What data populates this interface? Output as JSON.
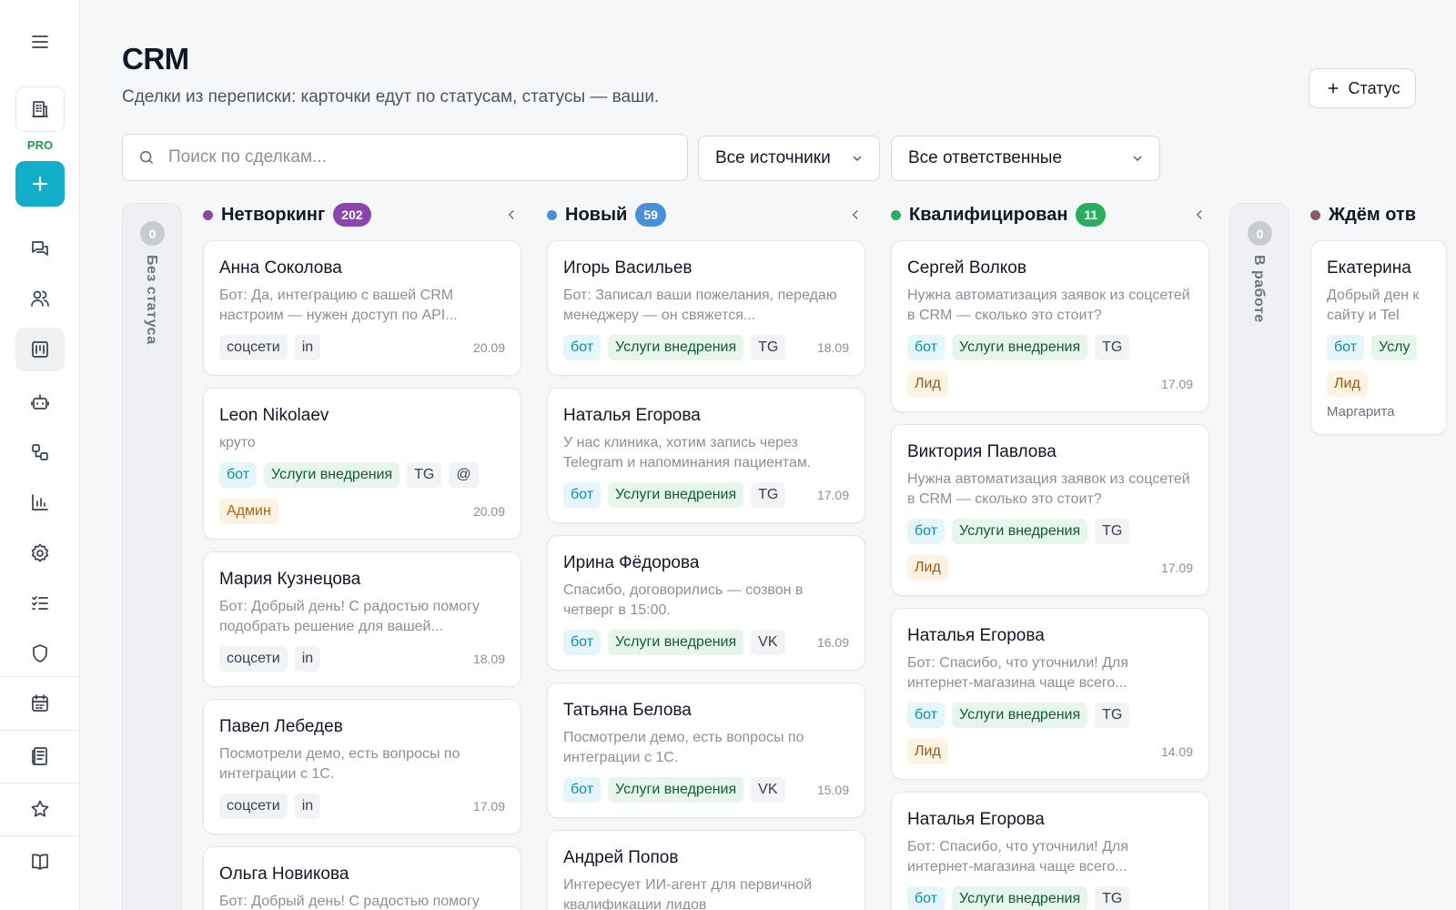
{
  "page": {
    "title": "CRM",
    "subtitle": "Сделки из переписки: карточки едут по статусам, статусы — ваши.",
    "add_status_label": "Статус"
  },
  "sidebar": {
    "pro_label": "PRO",
    "icons": [
      "menu-icon",
      "workspace-icon",
      "plus-icon",
      "chats-icon",
      "contacts-icon",
      "crm-board-icon",
      "bot-icon",
      "workflow-icon",
      "analytics-icon",
      "settings-icon",
      "tasks-icon",
      "shield-icon",
      "calendar-icon",
      "knowledge-icon",
      "star-icon",
      "book-icon"
    ]
  },
  "filters": {
    "search_placeholder": "Поиск по сделкам...",
    "source_value": "Все источники",
    "owner_value": "Все ответственные"
  },
  "collapsed_columns": [
    {
      "label": "Без статуса",
      "count": "0"
    },
    {
      "label": "В работе",
      "count": "0"
    }
  ],
  "columns": [
    {
      "name": "Нетворкинг",
      "count": "202",
      "color": "#8e44ad",
      "cards": [
        {
          "name": "Анна Соколова",
          "message": "Бот: Да, интеграцию с вашей CRM настроим — нужен доступ по API...",
          "tags": [
            "соцсети",
            "in"
          ],
          "date": "20.09"
        },
        {
          "name": "Leon Nikolaev",
          "message": "круто",
          "tags": [
            "бот",
            "Услуги внедрения",
            "TG",
            "@"
          ],
          "role": "Админ",
          "date": "20.09"
        },
        {
          "name": "Мария Кузнецова",
          "message": "Бот: Добрый день! С радостью помогу подобрать решение для вашей...",
          "tags": [
            "соцсети",
            "in"
          ],
          "date": "18.09"
        },
        {
          "name": "Павел Лебедев",
          "message": "Посмотрели демо, есть вопросы по интеграции с 1С.",
          "tags": [
            "соцсети",
            "in"
          ],
          "date": "17.09"
        },
        {
          "name": "Ольга Новикова",
          "message": "Бот: Добрый день! С радостью помогу",
          "tags": [],
          "date": ""
        }
      ]
    },
    {
      "name": "Новый",
      "count": "59",
      "color": "#4a90d9",
      "cards": [
        {
          "name": "Игорь Васильев",
          "message": "Бот: Записал ваши пожелания, передаю менеджеру — он свяжется...",
          "tags": [
            "бот",
            "Услуги внедрения",
            "TG"
          ],
          "date": "18.09"
        },
        {
          "name": "Наталья Егорова",
          "message": "У нас клиника, хотим запись через Telegram и напоминания пациентам.",
          "tags": [
            "бот",
            "Услуги внедрения",
            "TG"
          ],
          "date": "17.09"
        },
        {
          "name": "Ирина Фёдорова",
          "message": "Спасибо, договорились — созвон в четверг в 15:00.",
          "tags": [
            "бот",
            "Услуги внедрения",
            "VK"
          ],
          "date": "16.09"
        },
        {
          "name": "Татьяна Белова",
          "message": "Посмотрели демо, есть вопросы по интеграции с 1С.",
          "tags": [
            "бот",
            "Услуги внедрения",
            "VK"
          ],
          "date": "15.09"
        },
        {
          "name": "Андрей Попов",
          "message": "Интересует ИИ-агент для первичной квалификации лидов",
          "tags": [],
          "date": ""
        }
      ]
    },
    {
      "name": "Квалифицирован",
      "count": "11",
      "color": "#27ae60",
      "cards": [
        {
          "name": "Сергей Волков",
          "message": "Нужна автоматизация заявок из соцсетей в CRM — сколько это стоит?",
          "tags": [
            "бот",
            "Услуги внедрения",
            "TG"
          ],
          "role": "Лид",
          "date": "17.09"
        },
        {
          "name": "Виктория Павлова",
          "message": "Нужна автоматизация заявок из соцсетей в CRM — сколько это стоит?",
          "tags": [
            "бот",
            "Услуги внедрения",
            "TG"
          ],
          "role": "Лид",
          "date": "17.09"
        },
        {
          "name": "Наталья Егорова",
          "message": "Бот: Спасибо, что уточнили! Для интернет-магазина чаще всего...",
          "tags": [
            "бот",
            "Услуги внедрения",
            "TG"
          ],
          "role": "Лид",
          "date": "14.09"
        },
        {
          "name": "Наталья Егорова",
          "message": "Бот: Спасибо, что уточнили! Для интернет-магазина чаще всего...",
          "tags": [
            "бот",
            "Услуги внедрения",
            "TG"
          ],
          "date": ""
        }
      ]
    },
    {
      "name": "Ждём отв",
      "count": "",
      "color": "#8b5a6b",
      "cards": [
        {
          "name": "Екатерина",
          "message": "Добрый ден к сайту и Tel",
          "tags": [
            "бот",
            "Услу"
          ],
          "role": "Лид",
          "owner": "Маргарита",
          "date": ""
        }
      ]
    }
  ]
}
